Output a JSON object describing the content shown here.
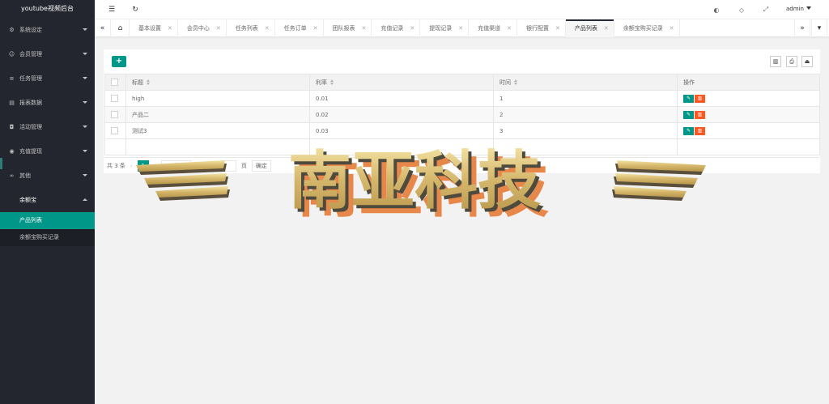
{
  "app": {
    "title": "youtube视频后台"
  },
  "sidebar": {
    "items": [
      {
        "label": "系统设定",
        "icon": "gear-icon"
      },
      {
        "label": "会员管理",
        "icon": "user-icon"
      },
      {
        "label": "任务管理",
        "icon": "list-icon"
      },
      {
        "label": "报表数据",
        "icon": "report-icon"
      },
      {
        "label": "活动管理",
        "icon": "gamepad-icon"
      },
      {
        "label": "充值提现",
        "icon": "money-icon"
      },
      {
        "label": "其他",
        "icon": "link-icon"
      },
      {
        "label": "余额宝",
        "icon": ""
      }
    ],
    "sub_items": [
      {
        "label": "产品列表"
      },
      {
        "label": "余额宝购买记录"
      }
    ]
  },
  "header": {
    "user": "admin"
  },
  "tabs": [
    {
      "label": "基本设置"
    },
    {
      "label": "会员中心"
    },
    {
      "label": "任务列表"
    },
    {
      "label": "任务订单"
    },
    {
      "label": "团队报表"
    },
    {
      "label": "充值记录"
    },
    {
      "label": "提现记录"
    },
    {
      "label": "充值渠道"
    },
    {
      "label": "银行配置"
    },
    {
      "label": "产品列表"
    },
    {
      "label": "余额宝购买记录"
    }
  ],
  "toolbar": {
    "add_label": "+"
  },
  "table": {
    "headers": [
      "标题",
      "利率",
      "时间",
      "操作"
    ],
    "rows": [
      {
        "title": "high",
        "rate": "0.01",
        "time": "1"
      },
      {
        "title": "产品二",
        "rate": "0.02",
        "time": "2"
      },
      {
        "title": "测试3",
        "rate": "0.03",
        "time": "3"
      }
    ]
  },
  "pager": {
    "total": "共 3 条",
    "current": "1",
    "page_size": "10 条/页",
    "goto_label": "到第",
    "page_unit": "页",
    "confirm": "确定"
  },
  "watermark": {
    "text": "南亚科技"
  },
  "colors": {
    "accent": "#009688",
    "danger": "#ff5722",
    "sidebar": "#23262e"
  }
}
